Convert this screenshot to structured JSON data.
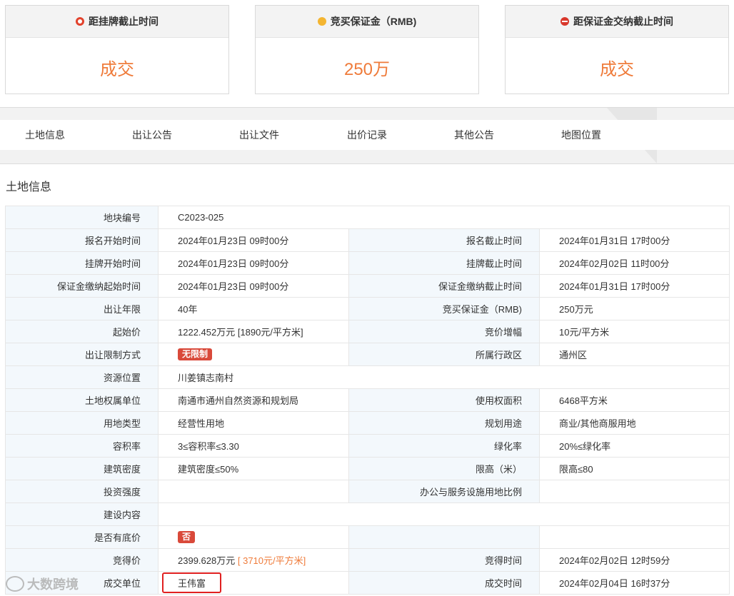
{
  "cards": [
    {
      "title": "距挂牌截止时间",
      "value": "成交",
      "icon": "clock-icon"
    },
    {
      "title": "竞买保证金（RMB)",
      "value": "250万",
      "icon": "coin-icon"
    },
    {
      "title": "距保证金交纳截止时间",
      "value": "成交",
      "icon": "alarm-icon"
    }
  ],
  "tabs": [
    "土地信息",
    "出让公告",
    "出让文件",
    "出价记录",
    "其他公告",
    "地图位置"
  ],
  "section_title": "土地信息",
  "rows": [
    {
      "l1": "地块编号",
      "v1": "C2023-025",
      "l2": "",
      "v2": ""
    },
    {
      "l1": "报名开始时间",
      "v1": "2024年01月23日 09时00分",
      "l2": "报名截止时间",
      "v2": "2024年01月31日 17时00分"
    },
    {
      "l1": "挂牌开始时间",
      "v1": "2024年01月23日 09时00分",
      "l2": "挂牌截止时间",
      "v2": "2024年02月02日 11时00分"
    },
    {
      "l1": "保证金缴纳起始时间",
      "v1": "2024年01月23日 09时00分",
      "l2": "保证金缴纳截止时间",
      "v2": "2024年01月31日 17时00分"
    },
    {
      "l1": "出让年限",
      "v1": "40年",
      "l2": "竞买保证金（RMB)",
      "v2": "250万元"
    },
    {
      "l1": "起始价",
      "v1": "1222.452万元 [1890元/平方米]",
      "l2": "竞价增幅",
      "v2": "10元/平方米"
    },
    {
      "l1": "出让限制方式",
      "v1": "无限制",
      "l2": "所属行政区",
      "v2": "通州区"
    },
    {
      "l1": "资源位置",
      "v1": "川姜镇志南村",
      "l2": "",
      "v2": ""
    },
    {
      "l1": "土地权属单位",
      "v1": "南通市通州自然资源和规划局",
      "l2": "使用权面积",
      "v2": "6468平方米"
    },
    {
      "l1": "用地类型",
      "v1": "经营性用地",
      "l2": "规划用途",
      "v2": "商业/其他商服用地"
    },
    {
      "l1": "容积率",
      "v1": "3≤容积率≤3.30",
      "l2": "绿化率",
      "v2": "20%≤绿化率"
    },
    {
      "l1": "建筑密度",
      "v1": "建筑密度≤50%",
      "l2": "限高（米）",
      "v2": "限高≤80"
    },
    {
      "l1": "投资强度",
      "v1": "",
      "l2": "办公与服务设施用地比例",
      "v2": ""
    },
    {
      "l1": "建设内容",
      "v1": "",
      "l2": "",
      "v2": ""
    },
    {
      "l1": "是否有底价",
      "v1": "否",
      "l2": "",
      "v2": ""
    },
    {
      "l1": "竞得价",
      "v1": "2399.628万元",
      "v1b": "[ 3710元/平方米]",
      "l2": "竞得时间",
      "v2": "2024年02月02日 12时59分"
    },
    {
      "l1": "成交单位",
      "v1": "王伟富",
      "l2": "成交时间",
      "v2": "2024年02月04日 16时37分"
    }
  ],
  "watermark": "大数跨境",
  "colors": {
    "accent_orange": "#ef7b3a",
    "tag_red": "#d9493a",
    "label_bg": "#f3f8fc",
    "highlight_border": "#e02020"
  }
}
